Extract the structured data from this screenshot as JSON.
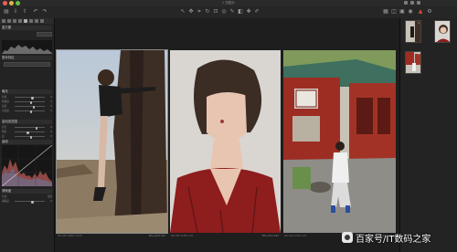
{
  "app": {
    "title": "1 张图片"
  },
  "toolbar": {
    "icons": [
      "folder-icon",
      "import-icon",
      "export-icon",
      "undo-icon",
      "redo-icon",
      "cursor-icon",
      "pan-icon",
      "crop-icon",
      "rotate-icon",
      "keystone-icon",
      "spot-icon",
      "brush-icon",
      "eraser-icon",
      "picker-icon",
      "annotate-icon",
      "grid-icon",
      "view-icon",
      "compare-icon",
      "proof-icon",
      "warning-icon"
    ]
  },
  "left_panel": {
    "sections": [
      "直方图",
      "基本特征",
      "曝光",
      "高动态范围",
      "曲线",
      "清晰度"
    ],
    "rows": [
      {
        "label": "色调",
        "value": "0"
      },
      {
        "label": "饱和度",
        "value": "0"
      },
      {
        "label": "亮度",
        "value": "0"
      },
      {
        "label": "对比度",
        "value": "0"
      },
      {
        "label": "高光",
        "value": "0"
      },
      {
        "label": "阴影",
        "value": "0"
      },
      {
        "label": "白",
        "value": "0"
      },
      {
        "label": "黑",
        "value": "0"
      },
      {
        "label": "方法",
        "value": "自然"
      },
      {
        "label": "清晰度",
        "value": "0"
      }
    ]
  },
  "photos": [
    {
      "caption_left": "ISO 100  1/500 s  f/2.8",
      "caption_mid": "",
      "caption_right": "IMG_0321.CR2"
    },
    {
      "caption_left": "ISO 200  1/250 s  f/2",
      "caption_mid": "",
      "caption_right": "IMG_0412.CR2"
    },
    {
      "caption_left": "ISO 100  1/320 s  f/4",
      "caption_mid": "",
      "caption_right": "IMG_0533.CR2"
    }
  ],
  "thumbnails": [
    {
      "index": "1"
    },
    {
      "index": "2"
    },
    {
      "index": "3"
    }
  ],
  "watermark": {
    "text": "百家号/IT数码之家"
  }
}
